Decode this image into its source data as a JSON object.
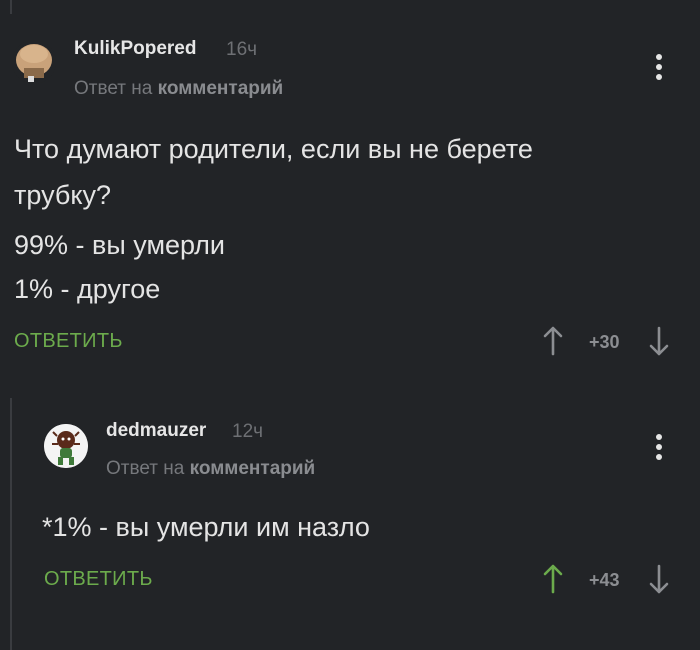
{
  "comments": [
    {
      "author": "KulikPopered",
      "time": "16ч",
      "reply_prefix": "Ответ на",
      "reply_target": "комментарий",
      "body_lines": [
        "Что думают родители, если вы не берете",
        "трубку?",
        "99% - вы умерли",
        "1% - другое"
      ],
      "reply_label": "ОТВЕТИТЬ",
      "score": "+30",
      "vote_up_color": "#8c8e92"
    },
    {
      "author": "dedmauzer",
      "time": "12ч",
      "reply_prefix": "Ответ на",
      "reply_target": "комментарий",
      "body_lines": [
        "*1% - вы умерли им назло"
      ],
      "reply_label": "ОТВЕТИТЬ",
      "score": "+43",
      "vote_up_color": "#6cab4c"
    }
  ],
  "colors": {
    "background": "#222427",
    "accent_green": "#6cab4c",
    "muted": "#76787c"
  }
}
